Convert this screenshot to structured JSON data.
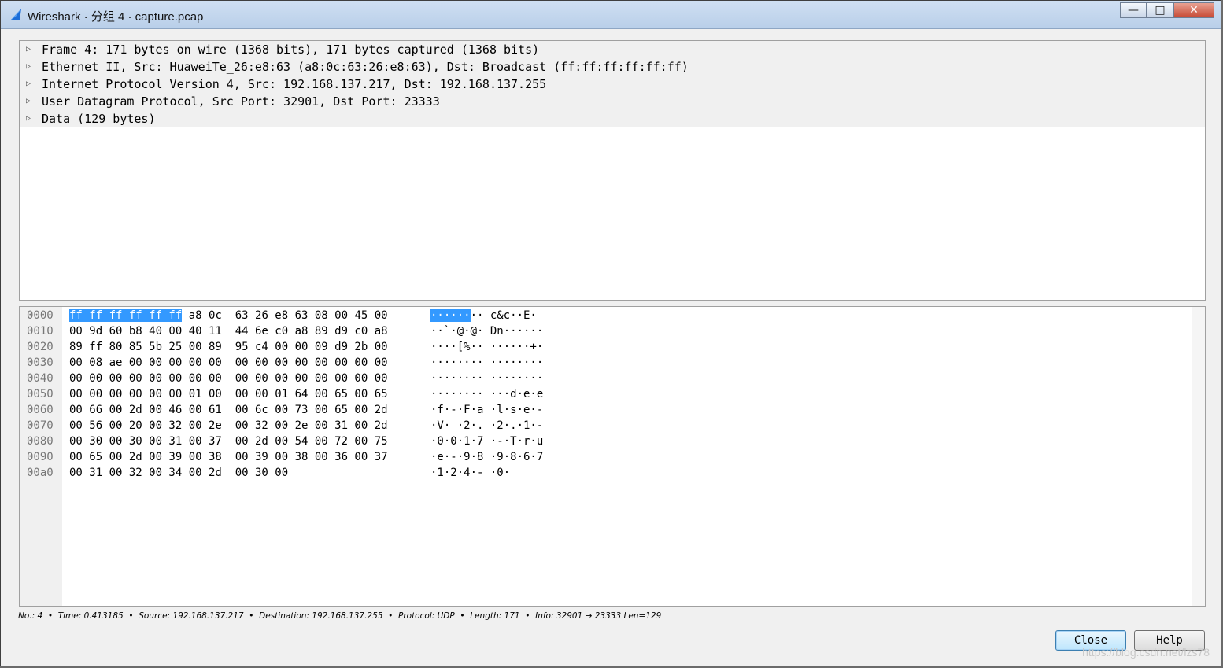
{
  "window": {
    "title": "Wireshark · 分组 4 · capture.pcap",
    "minimize_label": "—",
    "maximize_label": "□",
    "close_label": "✕"
  },
  "tree": [
    {
      "label": "Frame 4: 171 bytes on wire (1368 bits), 171 bytes captured (1368 bits)"
    },
    {
      "label": "Ethernet II, Src: HuaweiTe_26:e8:63 (a8:0c:63:26:e8:63), Dst: Broadcast (ff:ff:ff:ff:ff:ff)"
    },
    {
      "label": "Internet Protocol Version 4, Src: 192.168.137.217, Dst: 192.168.137.255"
    },
    {
      "label": "User Datagram Protocol, Src Port: 32901, Dst Port: 23333"
    },
    {
      "label": "Data (129 bytes)"
    }
  ],
  "hex": {
    "rows": [
      {
        "offset": "0000",
        "bytes_sel": "ff ff ff ff ff ff",
        "bytes": " a8 0c  63 26 e8 63 08 00 45 00",
        "ascii_sel": "······",
        "ascii": "·· c&c··E·"
      },
      {
        "offset": "0010",
        "bytes_sel": "",
        "bytes": "00 9d 60 b8 40 00 40 11  44 6e c0 a8 89 d9 c0 a8",
        "ascii_sel": "",
        "ascii": "··`·@·@· Dn······"
      },
      {
        "offset": "0020",
        "bytes_sel": "",
        "bytes": "89 ff 80 85 5b 25 00 89  95 c4 00 00 09 d9 2b 00",
        "ascii_sel": "",
        "ascii": "····[%·· ······+·"
      },
      {
        "offset": "0030",
        "bytes_sel": "",
        "bytes": "00 08 ae 00 00 00 00 00  00 00 00 00 00 00 00 00",
        "ascii_sel": "",
        "ascii": "········ ········"
      },
      {
        "offset": "0040",
        "bytes_sel": "",
        "bytes": "00 00 00 00 00 00 00 00  00 00 00 00 00 00 00 00",
        "ascii_sel": "",
        "ascii": "········ ········"
      },
      {
        "offset": "0050",
        "bytes_sel": "",
        "bytes": "00 00 00 00 00 00 01 00  00 00 01 64 00 65 00 65",
        "ascii_sel": "",
        "ascii": "········ ···d·e·e"
      },
      {
        "offset": "0060",
        "bytes_sel": "",
        "bytes": "00 66 00 2d 00 46 00 61  00 6c 00 73 00 65 00 2d",
        "ascii_sel": "",
        "ascii": "·f·-·F·a ·l·s·e·-"
      },
      {
        "offset": "0070",
        "bytes_sel": "",
        "bytes": "00 56 00 20 00 32 00 2e  00 32 00 2e 00 31 00 2d",
        "ascii_sel": "",
        "ascii": "·V· ·2·. ·2·.·1·-"
      },
      {
        "offset": "0080",
        "bytes_sel": "",
        "bytes": "00 30 00 30 00 31 00 37  00 2d 00 54 00 72 00 75",
        "ascii_sel": "",
        "ascii": "·0·0·1·7 ·-·T·r·u"
      },
      {
        "offset": "0090",
        "bytes_sel": "",
        "bytes": "00 65 00 2d 00 39 00 38  00 39 00 38 00 36 00 37",
        "ascii_sel": "",
        "ascii": "·e·-·9·8 ·9·8·6·7"
      },
      {
        "offset": "00a0",
        "bytes_sel": "",
        "bytes": "00 31 00 32 00 34 00 2d  00 30 00",
        "ascii_sel": "",
        "ascii": "·1·2·4·- ·0·"
      }
    ]
  },
  "status_line": "No.: 4  •  Time: 0.413185  •  Source: 192.168.137.217  •  Destination: 192.168.137.255  •  Protocol: UDP  •  Length: 171  •  Info: 32901 → 23333 Len=129",
  "buttons": {
    "close": "Close",
    "help": "Help"
  },
  "watermark": "https://blog.csdn.net/lzs78",
  "colors": {
    "selection": "#3399ff",
    "titlebar": "#b9cfe9"
  }
}
